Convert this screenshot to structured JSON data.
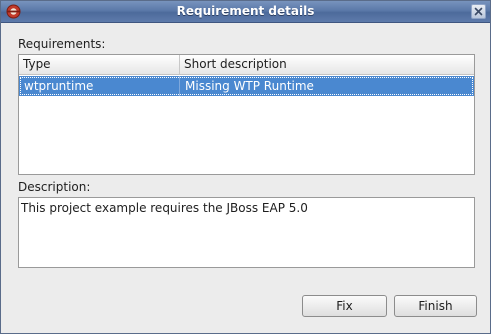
{
  "dialog": {
    "title": "Requirement details"
  },
  "requirements": {
    "label": "Requirements:",
    "columns": [
      "Type",
      "Short description"
    ],
    "rows": [
      {
        "type": "wtpruntime",
        "short_description": "Missing WTP Runtime",
        "selected": true
      }
    ]
  },
  "description": {
    "label": "Description:",
    "text": "This project example requires the JBoss EAP 5.0"
  },
  "buttons": {
    "fix": "Fix",
    "finish": "Finish"
  },
  "colors": {
    "titlebar": "#5b79a9",
    "selection": "#4a88d0",
    "dialog_bg": "#ececec"
  },
  "icons": {
    "title": "eclipse-app-icon",
    "close": "close-icon"
  }
}
